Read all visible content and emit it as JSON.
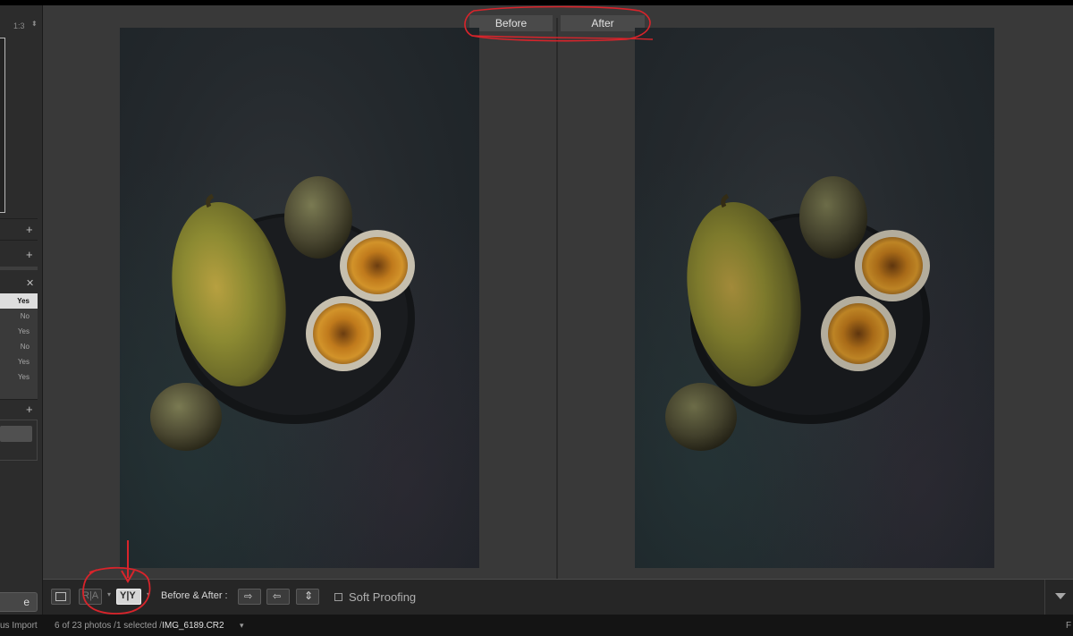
{
  "left_panel": {
    "zoom_ratio": "1:3",
    "zoom_arrows": "⬍",
    "table_rows": [
      "Yes",
      "No",
      "Yes",
      "No",
      "Yes",
      "Yes"
    ],
    "selected_row": 0,
    "bottom_button_label": "e"
  },
  "viewer": {
    "before_label": "Before",
    "after_label": "After"
  },
  "toolbar": {
    "before_after_label": "Before & After :",
    "soft_proofing_label": "Soft Proofing",
    "yy_label": "Y|Y",
    "ra_label": "R|A"
  },
  "filmstrip": {
    "import_text": "us Import",
    "count_text": "6 of 23 photos /1 selected /",
    "filename": "IMG_6189.CR2",
    "right_text": "F"
  },
  "colors": {
    "annotation_red": "#d8242b"
  }
}
